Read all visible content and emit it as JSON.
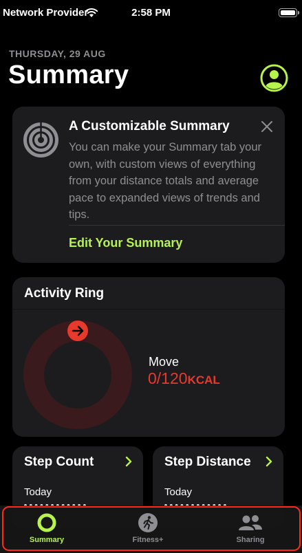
{
  "status_bar": {
    "carrier": "Network Provider",
    "time": "2:58 PM"
  },
  "header": {
    "date": "THURSDAY, 29 AUG",
    "title": "Summary"
  },
  "promo_card": {
    "title": "A Customizable Summary",
    "body": "You can make your Summary tab your own, with custom views of everything from your distance totals and average pace to expanded views of trends and tips.",
    "link": "Edit Your Summary"
  },
  "activity_ring": {
    "title": "Activity Ring",
    "move_label": "Move",
    "move_value": "0/120",
    "move_unit": "KCAL",
    "move_progress": 0
  },
  "step_count": {
    "title": "Step Count",
    "subtitle": "Today"
  },
  "step_distance": {
    "title": "Step Distance",
    "subtitle": "Today"
  },
  "tab_bar": {
    "tabs": [
      {
        "label": "Summary",
        "icon": "activity-ring-icon",
        "active": true
      },
      {
        "label": "Fitness+",
        "icon": "runner-icon",
        "active": false
      },
      {
        "label": "Sharing",
        "icon": "people-icon",
        "active": false
      }
    ]
  },
  "colors": {
    "accent": "#b6f34d",
    "move_red": "#e8392d",
    "card_bg": "#1c1c1e",
    "secondary_text": "#8e8e93",
    "highlight_outline": "#ff2a1a"
  }
}
